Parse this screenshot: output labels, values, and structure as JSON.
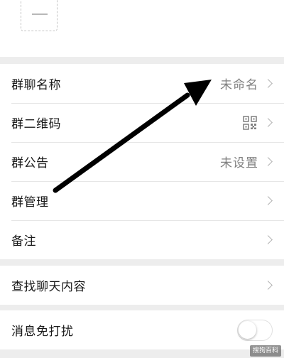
{
  "settings_group": [
    {
      "label": "群聊名称",
      "value": "未命名",
      "icon": "chevron-right-icon"
    },
    {
      "label": "群二维码",
      "value": "",
      "icon": "qr-code-icon"
    },
    {
      "label": "群公告",
      "value": "未设置",
      "icon": "chevron-right-icon"
    },
    {
      "label": "群管理",
      "value": "",
      "icon": "chevron-right-icon"
    },
    {
      "label": "备注",
      "value": "",
      "icon": "chevron-right-icon"
    }
  ],
  "search_group": {
    "label": "查找聊天内容",
    "icon": "chevron-right-icon"
  },
  "mute_group": {
    "label": "消息免打扰",
    "toggle_on": false
  },
  "annotation": {
    "type": "arrow",
    "color": "#000000",
    "pointing_to": "群聊名称 value"
  },
  "watermark": "搜狗百科",
  "colors": {
    "background": "#ededed",
    "row_background": "#ffffff",
    "primary_text": "#191919",
    "secondary_text": "#7f7f7f",
    "chevron": "#b2b2b2"
  }
}
